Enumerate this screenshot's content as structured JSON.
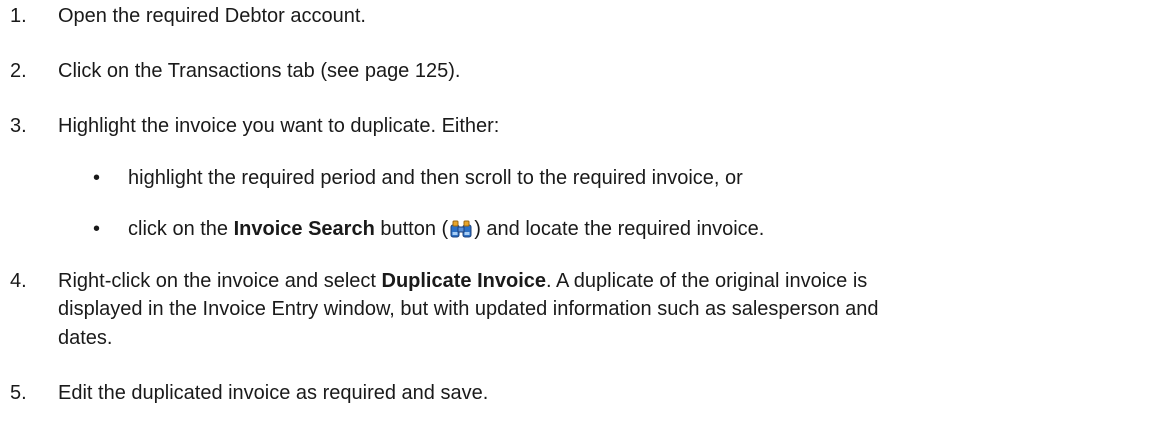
{
  "steps": [
    {
      "num": "1.",
      "text": "Open the required Debtor account."
    },
    {
      "num": "2.",
      "text": "Click on the Transactions tab (see page 125)."
    },
    {
      "num": "3.",
      "text": "Highlight the invoice you want to duplicate. Either:"
    },
    {
      "num": "4.",
      "text_a": "Right-click on the invoice and select ",
      "bold": "Duplicate Invoice",
      "text_b": ". A duplicate of the original invoice is",
      "line2": "displayed in the Invoice Entry window, but with updated information such as salesperson and",
      "line3": "dates."
    },
    {
      "num": "5.",
      "text": "Edit the duplicated invoice as required and save."
    }
  ],
  "bullets": [
    {
      "dot": "•",
      "text": "highlight the required period and then scroll to the required invoice, or"
    },
    {
      "dot": "•",
      "text_a": "click on the ",
      "bold": "Invoice Search",
      "text_b": " button (",
      "icon": "binoculars-icon",
      "text_c": ") and locate the required invoice."
    }
  ]
}
